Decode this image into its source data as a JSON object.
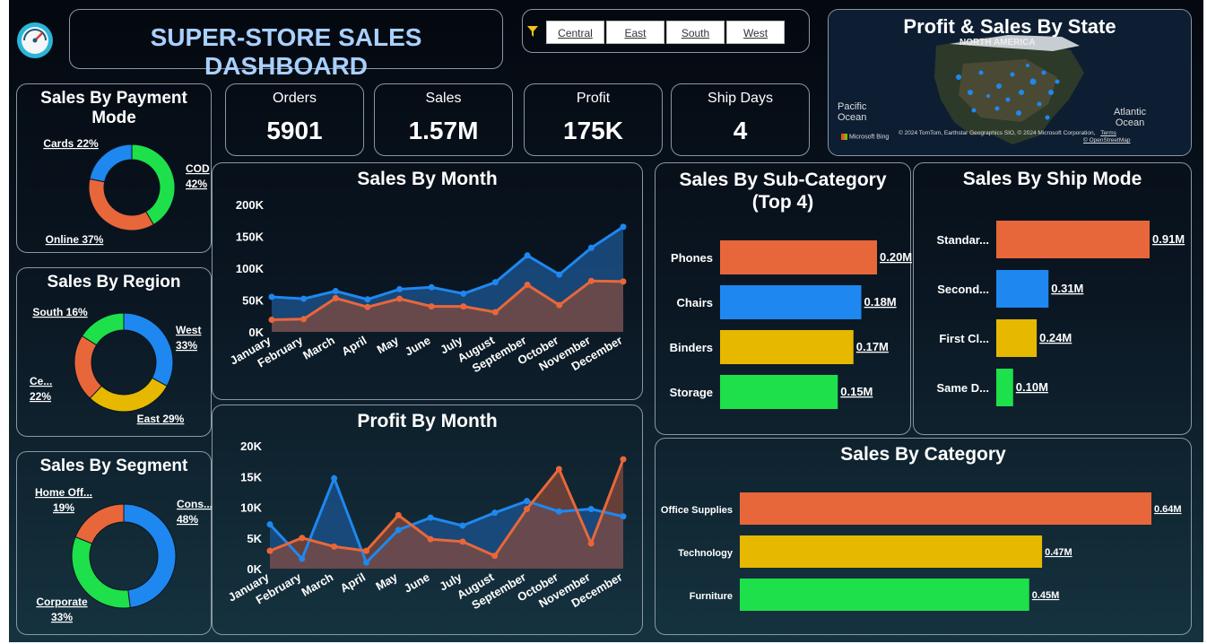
{
  "header": {
    "title": "SUPER-STORE SALES DASHBOARD",
    "icon": "speedometer-icon"
  },
  "filters": {
    "icon": "filter-icon",
    "regions": [
      "Central",
      "East",
      "South",
      "West"
    ]
  },
  "kpis": [
    {
      "label": "Orders",
      "value": "5901"
    },
    {
      "label": "Sales",
      "value": "1.57M"
    },
    {
      "label": "Profit",
      "value": "175K"
    },
    {
      "label": "Ship Days",
      "value": "4"
    }
  ],
  "map": {
    "title": "Profit & Sales By State",
    "labels": {
      "north_america": "NORTH AMERICA",
      "pacific": "Pacific\nOcean",
      "atlantic": "Atlantic\nOcean"
    },
    "attribution": "© 2024 TomTom, Earthstar Geographics SIO, © 2024 Microsoft Corporation,",
    "terms": "Terms",
    "osm": "© OpenStreetMap",
    "bing": "Microsoft Bing"
  },
  "payment": {
    "title": "Sales By Payment Mode",
    "slices": [
      {
        "name": "COD",
        "pct": 42,
        "label": "COD\n42%",
        "color": "#1ee04b"
      },
      {
        "name": "Online",
        "pct": 37,
        "label": "Online 37%",
        "color": "#e8673a"
      },
      {
        "name": "Cards",
        "pct": 22,
        "label": "Cards 22%",
        "color": "#1e88f0"
      }
    ]
  },
  "region": {
    "title": "Sales By Region",
    "slices": [
      {
        "name": "West",
        "pct": 33,
        "label": "West\n33%",
        "color": "#1e88f0"
      },
      {
        "name": "East",
        "pct": 29,
        "label": "East 29%",
        "color": "#e6b800"
      },
      {
        "name": "Ce...",
        "pct": 22,
        "label": "Ce...\n22%",
        "color": "#e8673a"
      },
      {
        "name": "South",
        "pct": 16,
        "label": "South 16%",
        "color": "#1ee04b"
      }
    ]
  },
  "segment": {
    "title": "Sales By Segment",
    "slices": [
      {
        "name": "Cons...",
        "pct": 48,
        "label": "Cons...\n48%",
        "color": "#1e88f0"
      },
      {
        "name": "Corporate",
        "pct": 33,
        "label": "Corporate\n33%",
        "color": "#1ee04b"
      },
      {
        "name": "Home Off...",
        "pct": 19,
        "label": "Home Off...\n19%",
        "color": "#e8673a"
      }
    ]
  },
  "sales_month": {
    "title": "Sales By Month",
    "yticks": [
      "200K",
      "150K",
      "100K",
      "50K",
      "0K"
    ]
  },
  "profit_month": {
    "title": "Profit By Month",
    "yticks": [
      "20K",
      "15K",
      "10K",
      "5K",
      "0K"
    ]
  },
  "chart_data": [
    {
      "type": "area",
      "title": "Sales By Month",
      "categories": [
        "January",
        "February",
        "March",
        "April",
        "May",
        "June",
        "July",
        "August",
        "September",
        "October",
        "November",
        "December"
      ],
      "ylim": [
        0,
        200000
      ],
      "series": [
        {
          "values": [
            55000,
            52000,
            64000,
            51000,
            67000,
            70000,
            60000,
            78000,
            120000,
            90000,
            132000,
            165000
          ],
          "color": "#1e88f0"
        },
        {
          "values": [
            19000,
            20000,
            53000,
            39000,
            52000,
            40000,
            40000,
            31000,
            74000,
            42000,
            80000,
            79000
          ],
          "color": "#e8673a"
        }
      ]
    },
    {
      "type": "area",
      "title": "Profit By Month",
      "categories": [
        "January",
        "February",
        "March",
        "April",
        "May",
        "June",
        "July",
        "August",
        "September",
        "October",
        "November",
        "December"
      ],
      "ylim": [
        0,
        20000
      ],
      "series": [
        {
          "values": [
            7200,
            1600,
            14700,
            1000,
            6300,
            8300,
            7000,
            9100,
            11000,
            9300,
            9700,
            8500
          ],
          "color": "#1e88f0"
        },
        {
          "values": [
            2900,
            5000,
            3600,
            2900,
            8700,
            4800,
            4400,
            2100,
            9700,
            16200,
            4100,
            17800
          ],
          "color": "#e8673a"
        }
      ]
    },
    {
      "type": "bar",
      "title": "Sales By Sub-Category (Top 4)",
      "categories": [
        "Phones",
        "Chairs",
        "Binders",
        "Storage"
      ],
      "values": [
        0.2,
        0.18,
        0.17,
        0.15
      ],
      "labels": [
        "0.20M",
        "0.18M",
        "0.17M",
        "0.15M"
      ],
      "colors": [
        "#e8673a",
        "#1e88f0",
        "#e6b800",
        "#1ee04b"
      ]
    },
    {
      "type": "bar",
      "title": "Sales By Ship Mode",
      "categories": [
        "Standar...",
        "Second...",
        "First Cl...",
        "Same D..."
      ],
      "values": [
        0.91,
        0.31,
        0.24,
        0.1
      ],
      "labels": [
        "0.91M",
        "0.31M",
        "0.24M",
        "0.10M"
      ],
      "colors": [
        "#e8673a",
        "#1e88f0",
        "#e6b800",
        "#1ee04b"
      ]
    },
    {
      "type": "bar",
      "title": "Sales By Category",
      "categories": [
        "Office Supplies",
        "Technology",
        "Furniture"
      ],
      "values": [
        0.64,
        0.47,
        0.45
      ],
      "labels": [
        "0.64M",
        "0.47M",
        "0.45M"
      ],
      "colors": [
        "#e8673a",
        "#e6b800",
        "#1ee04b"
      ]
    }
  ]
}
